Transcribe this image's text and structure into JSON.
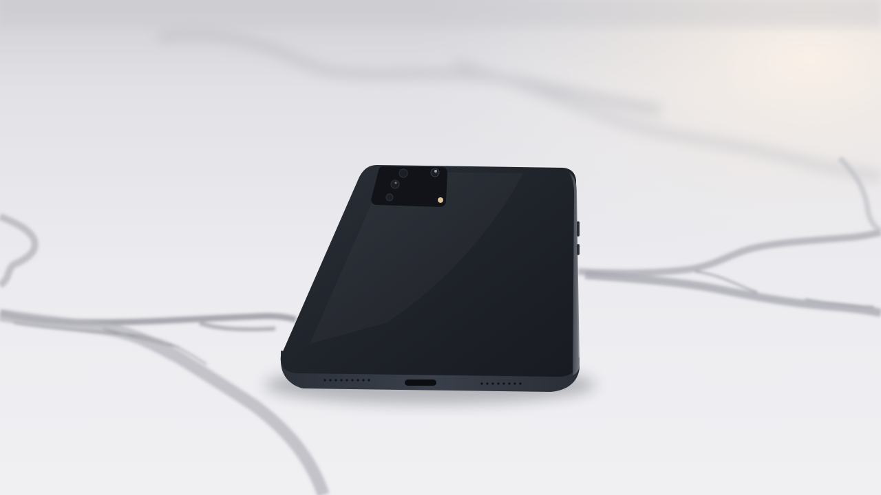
{
  "scene": {
    "subject": "phone-face-down",
    "surface": "marble",
    "colors": {
      "marble_base": "#ecebef",
      "marble_shadow": "#d9d9de",
      "warm_glow": "#f7eee6",
      "vein": "#9c9ca4",
      "phone_body": "#20242c",
      "phone_edge": "#30353f",
      "camera_module": "#111318",
      "lens_highlight": "#f2d9a8"
    }
  }
}
